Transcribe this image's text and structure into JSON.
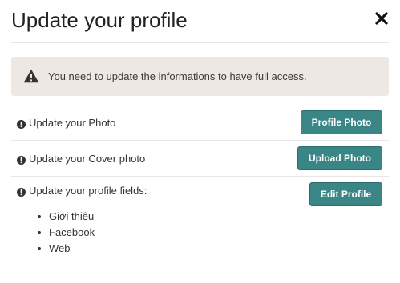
{
  "modal": {
    "title": "Update your profile",
    "close_icon": "close-icon"
  },
  "alert": {
    "icon": "warning-icon",
    "text": "You need to update the informations to have full access."
  },
  "tasks": [
    {
      "icon": "exclamation-circle-icon",
      "label": "Update your Photo",
      "button": "Profile Photo"
    },
    {
      "icon": "exclamation-circle-icon",
      "label": "Update your Cover photo",
      "button": "Upload Photo"
    },
    {
      "icon": "exclamation-circle-icon",
      "label": "Update your profile fields:",
      "button": "Edit Profile",
      "fields": [
        "Giới thiệu",
        "Facebook",
        "Web"
      ]
    }
  ],
  "colors": {
    "button_bg": "#3a8585",
    "alert_bg": "#ede8e3"
  }
}
